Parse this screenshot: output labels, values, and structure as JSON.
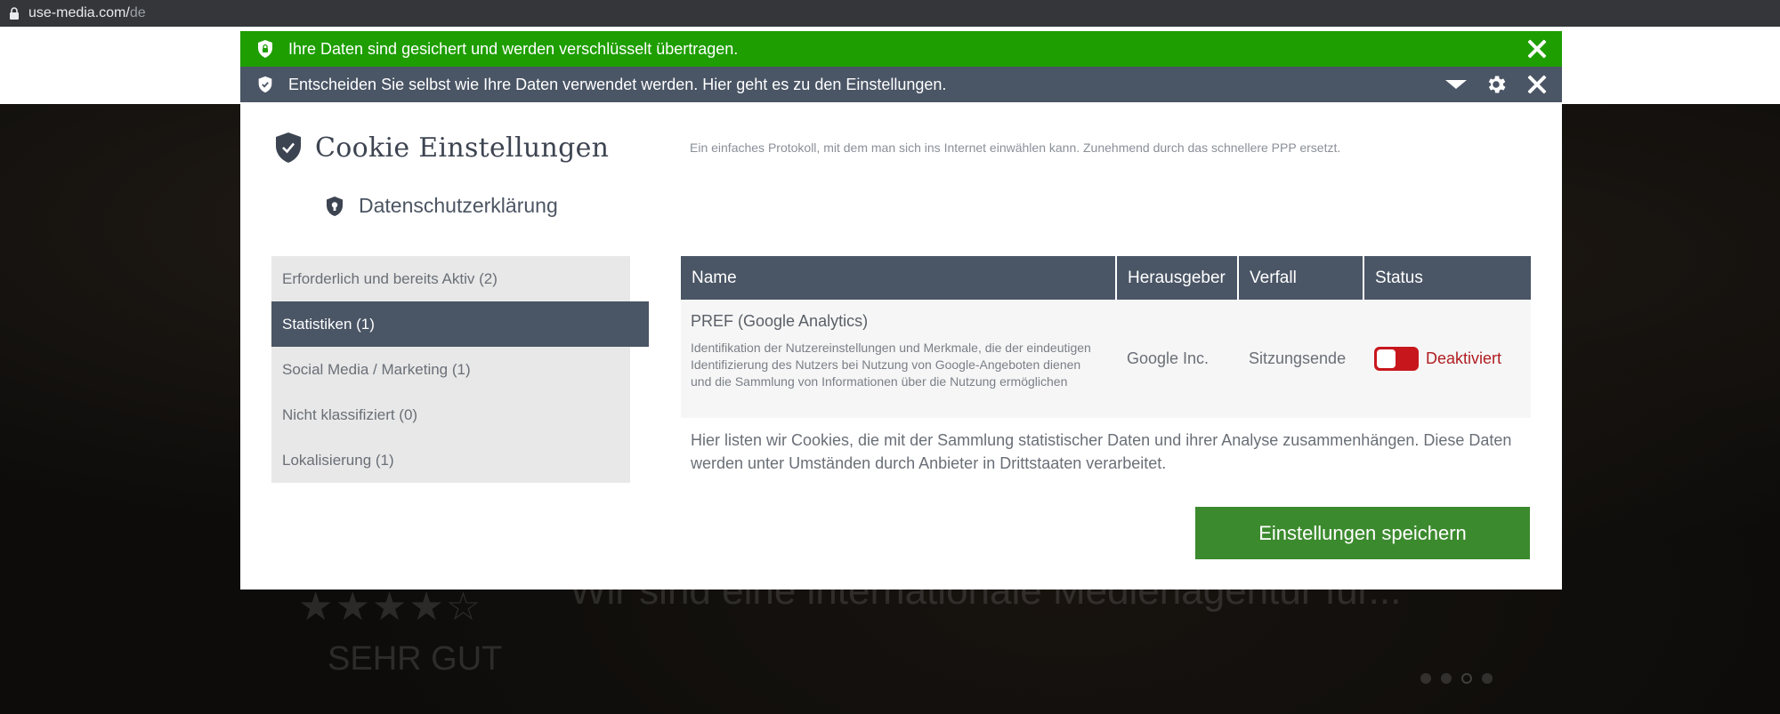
{
  "browser": {
    "url_host": "use-media.com/",
    "url_path": "de"
  },
  "hero": {
    "stars": "★★★★☆",
    "rating_label": "SEHR GUT",
    "headline": "Wir sind eine internationale Medienagentur für..."
  },
  "banners": {
    "secure_text": "Ihre Daten sind gesichert und werden verschlüsselt übertragen.",
    "settings_text": "Entscheiden Sie selbst wie Ihre Daten verwendet werden. Hier geht es zu den Einstellungen."
  },
  "modal": {
    "title": "Cookie Einstellungen",
    "privacy_link": "Datenschutzerklärung",
    "description": "Ein einfaches Protokoll, mit dem man sich ins Internet einwählen kann. Zunehmend durch das schnellere PPP ersetzt.",
    "categories": [
      {
        "label": "Erforderlich und bereits Aktiv (2)",
        "active": false
      },
      {
        "label": "Statistiken (1)",
        "active": true
      },
      {
        "label": "Social Media / Marketing (1)",
        "active": false
      },
      {
        "label": "Nicht klassifiziert (0)",
        "active": false
      },
      {
        "label": "Lokalisierung (1)",
        "active": false
      }
    ],
    "table": {
      "headers": [
        "Name",
        "Herausgeber",
        "Verfall",
        "Status"
      ],
      "rows": [
        {
          "name": "PREF (Google Analytics)",
          "description": "Identifikation der Nutzereinstellungen und Merkmale, die der eindeutigen Identifizierung des Nutzers bei Nutzung von Google-Angeboten dienen und die Sammlung von Informationen über die Nutzung ermöglichen",
          "publisher": "Google Inc.",
          "expiry": "Sitzungsende",
          "status": "Deaktiviert",
          "enabled": false
        }
      ]
    },
    "category_note": "Hier listen wir Cookies, die mit der Sammlung statistischer Daten und ihrer Analyse zusammenhängen. Diese Daten werden unter Umständen durch Anbieter in Drittstaaten verarbeitet.",
    "save_button": "Einstellungen speichern"
  },
  "colors": {
    "secure_bar": "#1e9e00",
    "settings_bar": "#4a5565",
    "save_button": "#3c8a2e",
    "toggle_off": "#c8161d"
  },
  "icons": {
    "address_bar": "lock-icon",
    "secure_bar": "shield-lock-icon",
    "settings_bar": "shield-check-icon",
    "expand": "caret-down-icon",
    "settings": "gear-icon",
    "close": "close-icon"
  }
}
